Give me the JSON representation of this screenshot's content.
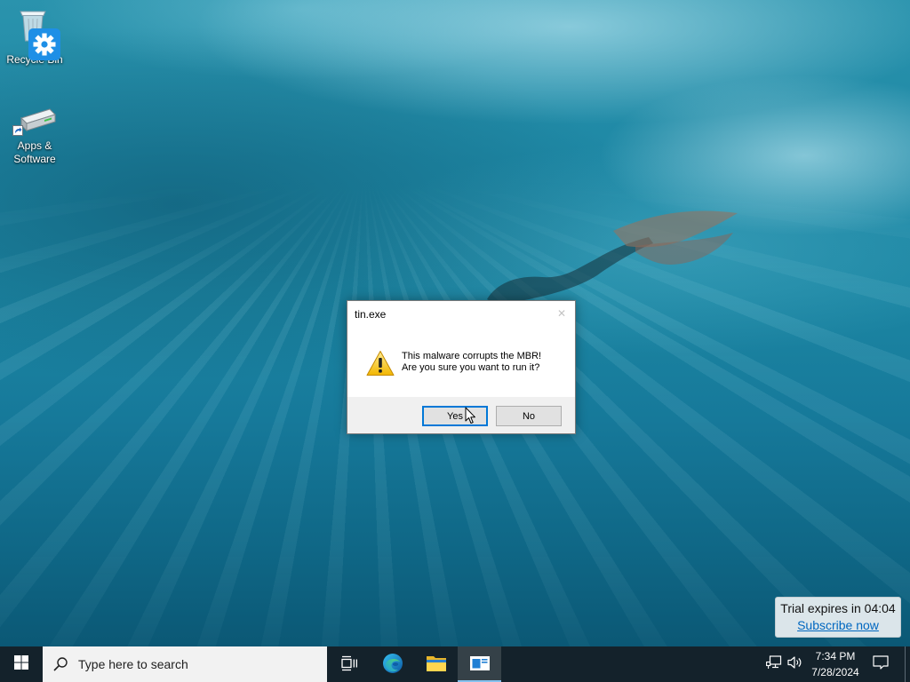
{
  "desktop": {
    "icons": [
      {
        "label": "Recycle Bin",
        "icon": "recycle-bin-icon",
        "overlay_icon": "gear-icon"
      },
      {
        "label": "Apps & Software",
        "icon": "drive-icon",
        "overlay_icon": "shortcut-arrow-icon"
      }
    ]
  },
  "dialog": {
    "title": "tin.exe",
    "close_glyph": "✕",
    "icon": "warning-icon",
    "message_line1": "This malware corrupts the MBR!",
    "message_line2": "Are you sure you want to run it?",
    "buttons": [
      {
        "label": "Yes",
        "focused": true
      },
      {
        "label": "No",
        "focused": false
      }
    ]
  },
  "trial_notice": {
    "text": "Trial expires in 04:04",
    "link_label": "Subscribe now"
  },
  "taskbar": {
    "start_icon": "windows-start-icon",
    "search": {
      "placeholder": "Type here to search",
      "icon": "search-icon"
    },
    "pinned": [
      {
        "icon": "task-view-icon",
        "active": false
      },
      {
        "icon": "edge-icon",
        "active": false
      },
      {
        "icon": "file-explorer-icon",
        "active": false
      },
      {
        "icon": "app-window-icon",
        "active": true
      }
    ],
    "tray": {
      "icons": [
        "network-icon",
        "volume-icon"
      ],
      "time": "7:34 PM",
      "date": "7/28/2024",
      "notification_icon": "notification-icon"
    }
  },
  "colors": {
    "accent": "#0078d7",
    "taskbar": "#14222b",
    "search_box": "#f2f2f2",
    "link": "#0067c0",
    "dialog_footer": "#f0f0f0",
    "wallpaper_top": "#2a93ad",
    "wallpaper_bottom": "#0b5875",
    "gear_badge": "#1e8fe6",
    "warning": "#f5c000"
  }
}
